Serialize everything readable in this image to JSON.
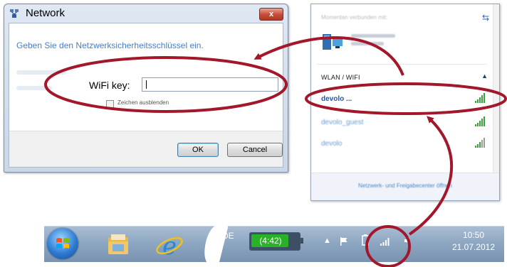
{
  "dialog": {
    "title": "Network",
    "close_label": "x",
    "instruction": "Geben Sie den Netzwerksicherheitsschlüssel ein.",
    "wifi_key_label": "WiFi key:",
    "wifi_key_value": "",
    "hide_chars_label": "Zeichen ausblenden",
    "hide_chars_checked": false,
    "ok_label": "OK",
    "cancel_label": "Cancel"
  },
  "network_panel": {
    "connected_to": "Momentan verbunden mit:",
    "connected_network_icon": "network-computer-icon",
    "section_title": "WLAN / WIFI",
    "networks": [
      {
        "name": "devolo ...",
        "selected": true,
        "signal_icon": "wifi-signal-icon"
      },
      {
        "name": "devolo_guest",
        "selected": false,
        "signal_icon": "wifi-signal-icon"
      },
      {
        "name": "devolo",
        "selected": false,
        "signal_icon": "wifi-signal-icon"
      }
    ],
    "footer_link": "Netzwerk- und Freigabecenter öffnen"
  },
  "taskbar": {
    "language": "DE",
    "battery_time": "(4:42)",
    "time": "10:50",
    "date": "21.07.2012"
  },
  "colors": {
    "annotation": "#a3172b",
    "link_blue": "#2d6ab4",
    "taskbar": "#8ea7c2"
  }
}
